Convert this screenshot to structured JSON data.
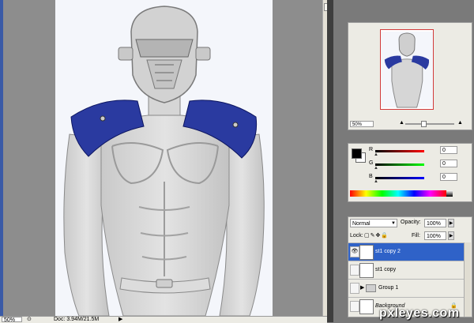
{
  "status_bar": {
    "zoom": "50%",
    "doc_info": "Doc: 3.94M/21.5M",
    "arrow": "▶"
  },
  "navigator": {
    "zoom": "50%"
  },
  "color_panel": {
    "foreground": "#000000",
    "background": "#ffffff",
    "channels": [
      {
        "label": "R",
        "value": "0"
      },
      {
        "label": "G",
        "value": "0"
      },
      {
        "label": "B",
        "value": "0"
      }
    ]
  },
  "layers_panel": {
    "blend_mode": "Normal",
    "opacity_label": "Opacity:",
    "opacity": "100%",
    "lock_label": "Lock:",
    "fill_label": "Fill:",
    "fill": "100%",
    "layers": [
      {
        "name": "st1 copy 2",
        "selected": true,
        "visible": true
      },
      {
        "name": "st1 copy",
        "selected": false,
        "visible": false
      },
      {
        "name": "Group 1",
        "selected": false,
        "visible": false
      },
      {
        "name": "Background",
        "selected": false,
        "visible": false
      }
    ]
  },
  "watermark": "pxleyes.com",
  "colors": {
    "shoulder_blue": "#2a3aa0",
    "selection": "#2f62c8"
  }
}
